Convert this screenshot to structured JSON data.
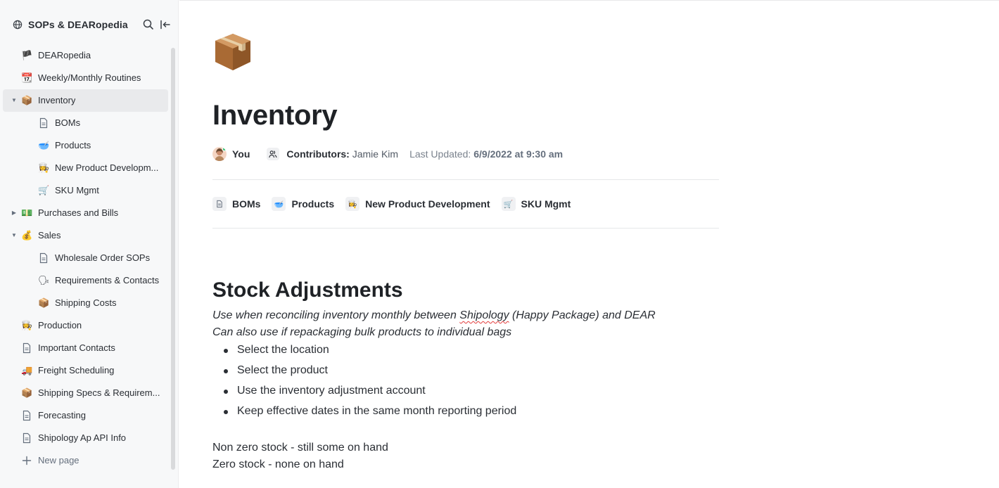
{
  "sidebar": {
    "workspace_title": "SOPs & DEARopedia",
    "items": [
      {
        "label": "DEARopedia",
        "icon": "flag-icon",
        "glyph": "🏴",
        "level": 1
      },
      {
        "label": "Weekly/Monthly Routines",
        "icon": "calendar-icon",
        "glyph": "📆",
        "level": 1
      },
      {
        "label": "Inventory",
        "icon": "package-icon",
        "glyph": "📦",
        "level": 1,
        "expanded": true,
        "active": true
      },
      {
        "label": "BOMs",
        "icon": "document-icon",
        "glyph": "🗎",
        "level": 2
      },
      {
        "label": "Products",
        "icon": "bowl-icon",
        "glyph": "🥣",
        "level": 2
      },
      {
        "label": "New Product Developm...",
        "icon": "chef-icon",
        "glyph": "👩‍🍳",
        "level": 2
      },
      {
        "label": "SKU Mgmt",
        "icon": "cart-icon",
        "glyph": "🛒",
        "level": 2
      },
      {
        "label": "Purchases and Bills",
        "icon": "money-icon",
        "glyph": "💵",
        "level": 1,
        "collapsed": true
      },
      {
        "label": "Sales",
        "icon": "moneybag-icon",
        "glyph": "💰",
        "level": 1,
        "expanded": true
      },
      {
        "label": "Wholesale Order SOPs",
        "icon": "document-icon",
        "glyph": "🗎",
        "level": 2
      },
      {
        "label": "Requirements & Contacts",
        "icon": "speaking-head-icon",
        "glyph": "🗣",
        "level": 2
      },
      {
        "label": "Shipping Costs",
        "icon": "package-icon",
        "glyph": "📦",
        "level": 2
      },
      {
        "label": "Production",
        "icon": "chef-icon",
        "glyph": "👩‍🍳",
        "level": 1
      },
      {
        "label": "Important Contacts",
        "icon": "document-icon",
        "glyph": "🗎",
        "level": 1
      },
      {
        "label": "Freight Scheduling",
        "icon": "truck-icon",
        "glyph": "🚚",
        "level": 1
      },
      {
        "label": "Shipping Specs & Requirem...",
        "icon": "package-icon",
        "glyph": "📦",
        "level": 1
      },
      {
        "label": "Forecasting",
        "icon": "document-icon",
        "glyph": "🗎",
        "level": 1
      },
      {
        "label": "Shipology Ap API Info",
        "icon": "document-icon",
        "glyph": "🗎",
        "level": 1
      }
    ],
    "new_page_label": "New page"
  },
  "page": {
    "title": "Inventory",
    "author": "You",
    "contributors_label": "Contributors:",
    "contributors_names": " Jamie Kim",
    "last_updated_label": "Last Updated:",
    "last_updated_value": "6/9/2022 at 9:30 am",
    "subpages": [
      {
        "label": "BOMs",
        "icon": "document-icon",
        "glyph": "🗎"
      },
      {
        "label": "Products",
        "icon": "bowl-icon",
        "glyph": "🥣"
      },
      {
        "label": "New Product Development",
        "icon": "chef-icon",
        "glyph": "👩‍🍳"
      },
      {
        "label": "SKU Mgmt",
        "icon": "cart-icon",
        "glyph": "🛒"
      }
    ],
    "section_heading": "Stock Adjustments",
    "note_line1_before": "Use when reconciling inventory monthly between ",
    "note_line1_misspelled": "Shipology",
    "note_line1_after": " (Happy Package) and DEAR",
    "note_line2": "Can also use if repackaging bulk products to individual bags",
    "bullets": [
      "Select the location",
      "Select the product",
      "Use the inventory adjustment account",
      "Keep effective dates in the same month reporting period"
    ],
    "para1": "Non zero stock - still some on hand",
    "para2": "Zero stock - none on hand"
  }
}
